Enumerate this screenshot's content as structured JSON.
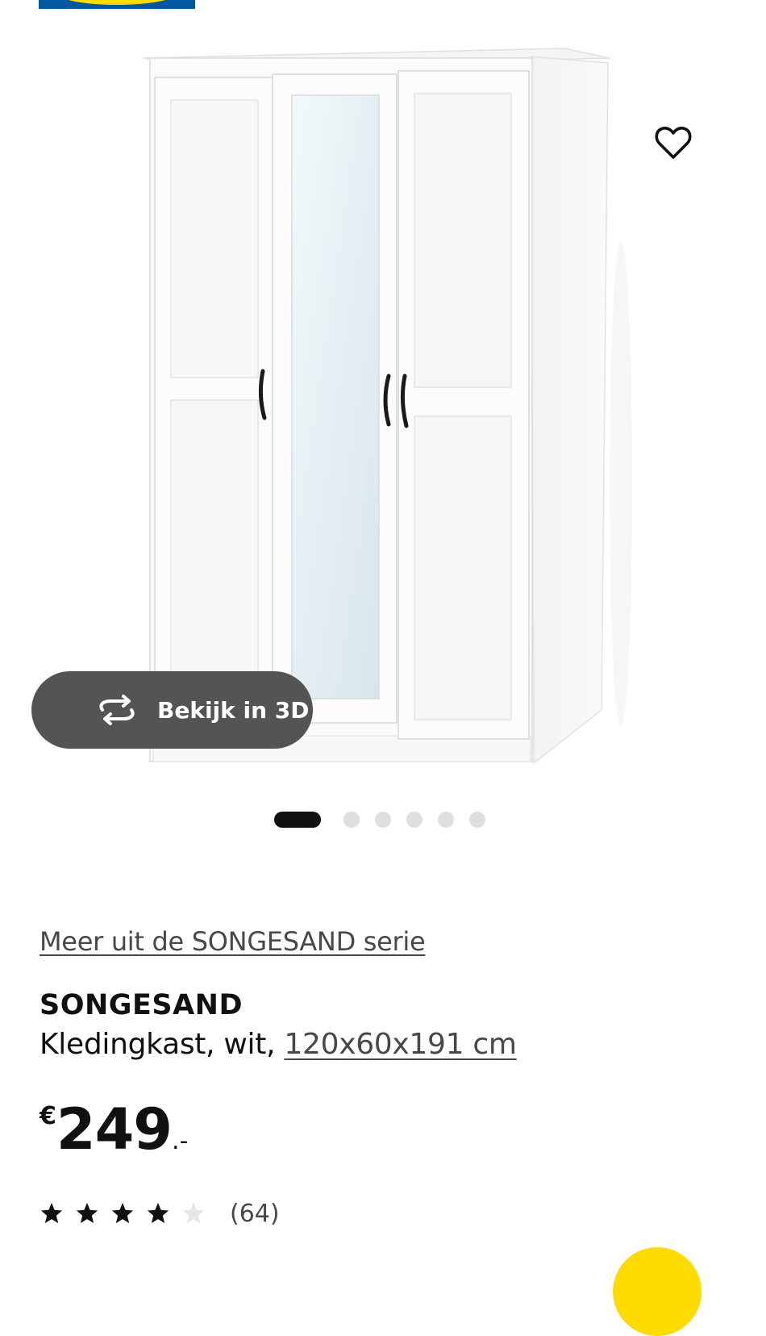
{
  "header": {
    "logo_icon": "ikea-logo-icon"
  },
  "product_image": {
    "alt_subject": "wardrobe",
    "wishlist_icon": "heart-outline-icon",
    "view_3d": {
      "icon": "rotate-3d-icon",
      "label": "Bekijk in 3D"
    }
  },
  "carousel": {
    "total": 6,
    "active_index": 0
  },
  "series_link": "Meer uit de SONGESAND serie",
  "product": {
    "name": "SONGESAND",
    "description": "Kledingkast, wit, ",
    "measurements": "120x60x191 cm"
  },
  "price": {
    "currency": "€",
    "integer": "249",
    "suffix": ".-"
  },
  "rating": {
    "stars_filled": 4,
    "stars_total": 5,
    "count": "(64)"
  },
  "colors": {
    "ikea_blue": "#0058a3",
    "ikea_yellow": "#ffdb00",
    "button_dark": "#545454",
    "link_gray": "#484848"
  }
}
